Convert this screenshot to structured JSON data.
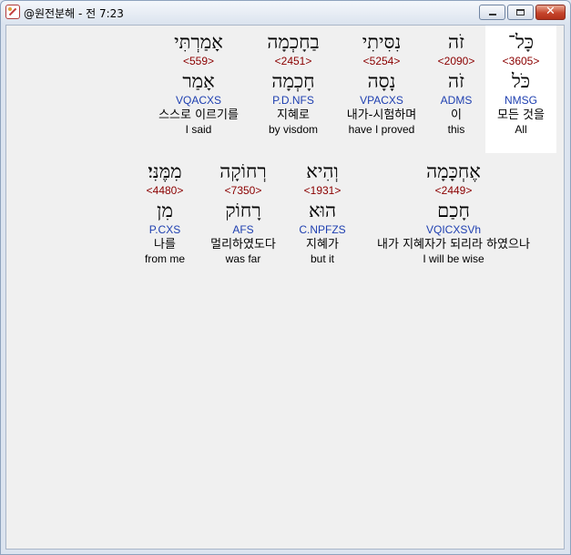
{
  "window": {
    "title": "@원전분해 - 전 7:23",
    "close_glyph": "✕"
  },
  "words": [
    {
      "surface": "כָּל־",
      "strong": "<3605>",
      "lemma": "כֹּל",
      "parse": "NMSG",
      "korean": "모든 것을",
      "english": "All",
      "highlighted": true
    },
    {
      "surface": "זֹה",
      "strong": "<2090>",
      "lemma": "זֹה",
      "parse": "ADMS",
      "korean": "이",
      "english": "this"
    },
    {
      "surface": "נִסִּיתִי",
      "strong": "<5254>",
      "lemma": "נָסָה",
      "parse": "VPACXS",
      "korean": "내가-시험하며",
      "english": "have I proved"
    },
    {
      "surface": "בַחָכְמָה",
      "strong": "<2451>",
      "lemma": "חָכְמָה",
      "parse": "P.D.NFS",
      "korean": "지혜로",
      "english": "by visdom"
    },
    {
      "surface": "אָמַרְתִּי",
      "strong": "<559>",
      "lemma": "אָמַר",
      "parse": "VQACXS",
      "korean": "스스로 이르기를",
      "english": "I said"
    },
    {
      "surface": "אֶחְכָּמָה",
      "strong": "<2449>",
      "lemma": "חָכַם",
      "parse": "VQICXSVh",
      "korean": "내가 지혜자가 되리라 하였으나",
      "english": "I will be wise"
    },
    {
      "surface": "וְהִיא",
      "strong": "<1931>",
      "lemma": "הוּא",
      "parse": "C.NPFZS",
      "korean": "지혜가",
      "english": "but it"
    },
    {
      "surface": "רְחוֹקָה",
      "strong": "<7350>",
      "lemma": "רָחוֹק",
      "parse": "AFS",
      "korean": "멀리하였도다",
      "english": "was far"
    },
    {
      "surface": "מִמֶּנִּי׃",
      "strong": "<4480>",
      "lemma": "מִן",
      "parse": "P.CXS",
      "korean": "나를",
      "english": "from me"
    }
  ]
}
